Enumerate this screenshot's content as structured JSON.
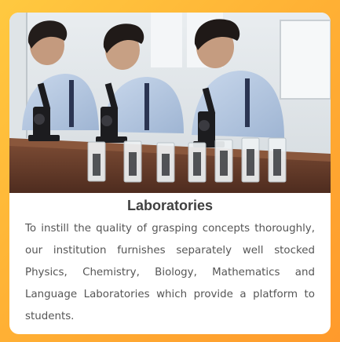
{
  "card": {
    "title": "Laboratories",
    "description": "To instill the quality of grasping concepts thoroughly, our institution furnishes separately well stocked Physics, Chemistry, Biology, Mathematics and Language Laboratories which provide a platform to students."
  },
  "colors": {
    "frame_gradient_start": "#ffc940",
    "frame_gradient_end": "#ff9a2c",
    "card_background": "#ffffff",
    "title_color": "#404040",
    "text_color": "#555555"
  }
}
